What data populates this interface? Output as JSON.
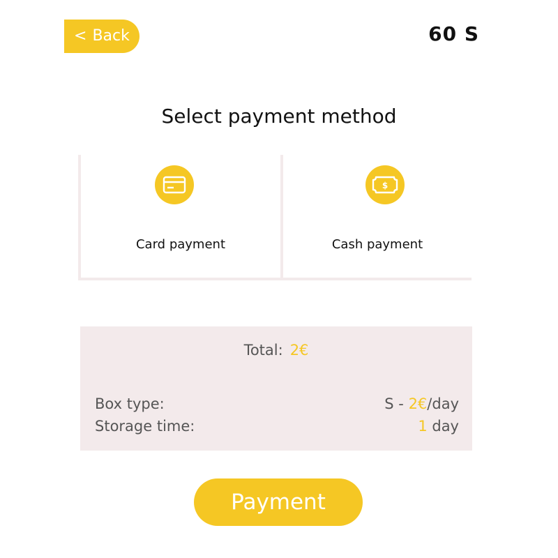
{
  "header": {
    "back_chevron": "<",
    "back_label": "Back",
    "timer": "60 S"
  },
  "title": "Select payment method",
  "methods": [
    {
      "label": "Card payment",
      "icon": "credit-card-icon"
    },
    {
      "label": "Cash payment",
      "icon": "cash-banknote-icon"
    }
  ],
  "summary": {
    "total_label": "Total:",
    "total_value": "2€",
    "box_type_label": "Box type:",
    "box_type_size": "S - ",
    "box_type_price": "2€",
    "box_type_unit": "/day",
    "storage_time_label": "Storage time:",
    "storage_time_count": "1",
    "storage_time_unit": " day"
  },
  "payment_button_label": "Payment",
  "colors": {
    "accent": "#F5C724",
    "panel": "#F3EAEB",
    "text": "#111111",
    "muted_text": "#555555"
  }
}
